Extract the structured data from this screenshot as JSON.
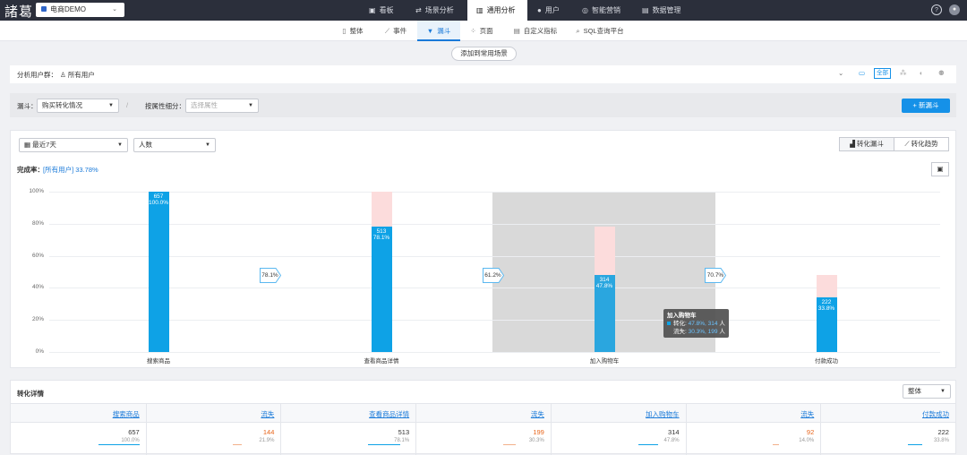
{
  "header": {
    "logo": "諸葛",
    "project": "电商DEMO",
    "dropdown": "⌄",
    "nav": [
      {
        "icon": "▣",
        "label": "看板"
      },
      {
        "icon": "⇄",
        "label": "场景分析"
      },
      {
        "icon": "▥",
        "label": "通用分析"
      },
      {
        "icon": "●",
        "label": "用户"
      },
      {
        "icon": "◎",
        "label": "智能营销"
      },
      {
        "icon": "▤",
        "label": "数据管理"
      }
    ],
    "help": "?",
    "avatar": "●"
  },
  "subnav": [
    {
      "icon": "▯",
      "label": "整体"
    },
    {
      "icon": "⟋",
      "label": "事件"
    },
    {
      "icon": "▼",
      "label": "漏斗"
    },
    {
      "icon": "⁘",
      "label": "页面"
    },
    {
      "icon": "▤",
      "label": "自定义指标"
    },
    {
      "icon": "⌕",
      "label": "SQL查询平台"
    }
  ],
  "add_scene": "添加到常用场景",
  "user_group": {
    "label": "分析用户群：",
    "value": "所有用户",
    "expand": "⌄",
    "platforms": [
      "▭",
      "全部",
      "⁂",
      "",
      "⚉"
    ]
  },
  "funnel_bar": {
    "label": "漏斗：",
    "funnel": "购买转化情况",
    "divider": "/",
    "breakdown_label": "按属性细分：",
    "breakdown_placeholder": "选择属性",
    "new_button": "+ 新漏斗"
  },
  "chart_controls": {
    "date_range": "最近7天",
    "metric": "人数",
    "view_funnel": "转化漏斗",
    "view_trend": "转化趋势",
    "completion_label": "完成率：",
    "completion_value": "[所有用户] 33.78%",
    "icon": "▣"
  },
  "colors": {
    "bar": "#0ea2e6",
    "loss": "#fcdcdc",
    "accent": "#1591e8",
    "loss_text": "#e8651b"
  },
  "chart_data": {
    "type": "bar",
    "categories": [
      "搜索商品",
      "查看商品详情",
      "加入购物车",
      "付款成功"
    ],
    "values": [
      100.0,
      78.1,
      47.8,
      33.8
    ],
    "counts": [
      "657",
      "513",
      "314",
      "222"
    ],
    "pcts": [
      "100.0%",
      "78.1%",
      "47.8%",
      "33.8%"
    ],
    "ghost": [
      100,
      100,
      78.1,
      47.8
    ],
    "step_rates": [
      "78.1%",
      "61.2%",
      "70.7%"
    ],
    "yticks": [
      "100%",
      "80%",
      "60%",
      "40%",
      "20%",
      "0%"
    ],
    "ylim": [
      0,
      100
    ],
    "tooltip": {
      "title": "加入购物车",
      "conv_label": "转化:",
      "conv": "47.8%, 314",
      "unit": "人",
      "loss_label": "流失:",
      "loss": "30.3%, 199"
    }
  },
  "detail": {
    "title": "转化详情",
    "scope": "整体",
    "headers": [
      "搜索商品",
      "流失",
      "查看商品详情",
      "流失",
      "加入购物车",
      "流失",
      "付款成功"
    ],
    "values": [
      "657",
      "144",
      "513",
      "199",
      "314",
      "92",
      "222"
    ],
    "percents": [
      "100.0%",
      "21.9%",
      "78.1%",
      "30.3%",
      "47.8%",
      "14.0%",
      "33.8%"
    ],
    "fills": [
      1.0,
      0.219,
      0.781,
      0.303,
      0.478,
      0.14,
      0.338
    ]
  }
}
